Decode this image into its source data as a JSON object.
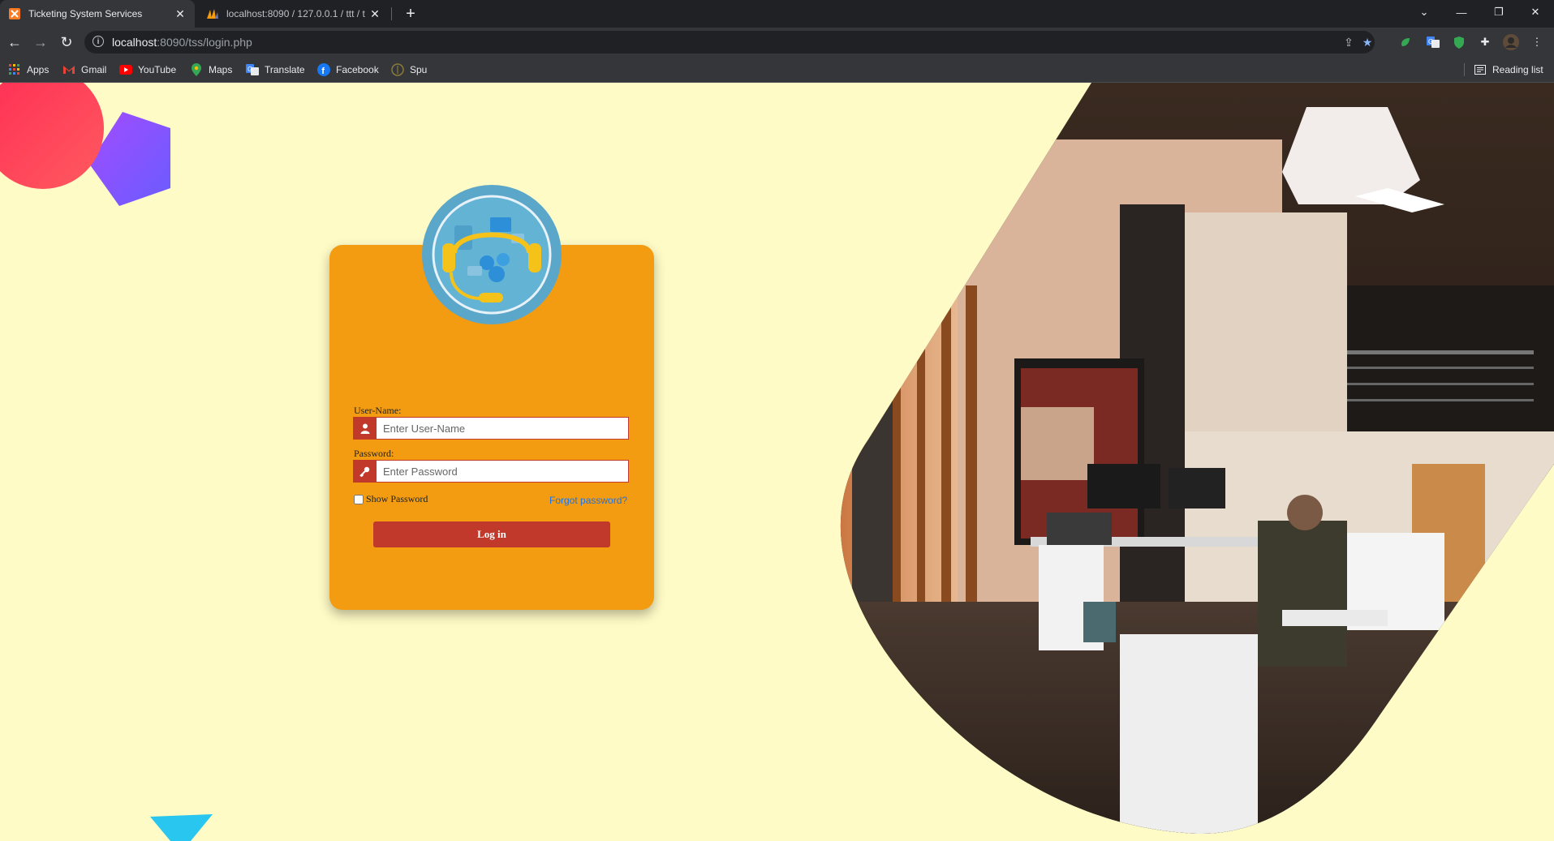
{
  "browser": {
    "tabs": [
      {
        "title": "Ticketing System Services",
        "active": true,
        "icon": "xampp-icon"
      },
      {
        "title": "localhost:8090 / 127.0.0.1 / ttt / t",
        "active": false,
        "icon": "phpmyadmin-icon"
      }
    ],
    "address": {
      "host": "localhost",
      "path": ":8090/tss/login.php"
    },
    "bookmarks": [
      {
        "label": "Apps",
        "icon": "apps-grid-icon"
      },
      {
        "label": "Gmail",
        "icon": "gmail-icon"
      },
      {
        "label": "YouTube",
        "icon": "youtube-icon"
      },
      {
        "label": "Maps",
        "icon": "maps-pin-icon"
      },
      {
        "label": "Translate",
        "icon": "translate-icon"
      },
      {
        "label": "Facebook",
        "icon": "facebook-icon"
      },
      {
        "label": "Spu",
        "icon": "spu-icon"
      }
    ],
    "reading_list": "Reading list"
  },
  "login": {
    "username_label": "User-Name:",
    "username_placeholder": "Enter User-Name",
    "username_value": "",
    "password_label": "Password:",
    "password_placeholder": "Enter Password",
    "password_value": "",
    "show_password_label": "Show Password",
    "show_password_checked": false,
    "forgot_label": "Forgot password?",
    "login_button": "Log in"
  },
  "colors": {
    "background": "#fffbc6",
    "card": "#f39c12",
    "accent": "#c0392b",
    "link": "#1a73e8",
    "logo_ring": "#5ba7c9"
  }
}
